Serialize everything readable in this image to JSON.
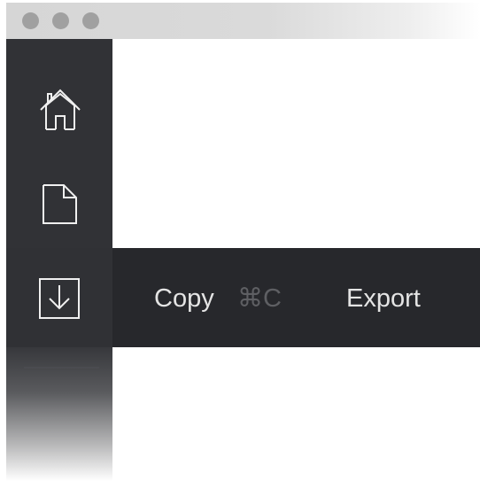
{
  "window": {
    "controls": [
      "close",
      "minimize",
      "zoom"
    ]
  },
  "sidebar": {
    "items": [
      {
        "icon": "home-icon"
      },
      {
        "icon": "file-icon"
      },
      {
        "icon": "download-icon"
      }
    ]
  },
  "context_menu": {
    "copy_label": "Copy",
    "copy_shortcut": "⌘C",
    "export_label": "Export"
  },
  "colors": {
    "titlebar": "#d6d6d6",
    "traffic_light": "#a0a0a0",
    "sidebar": "#313236",
    "context_bar": "#27282c",
    "menu_text": "#e4e4e4",
    "shortcut_text": "#5e5f63"
  }
}
